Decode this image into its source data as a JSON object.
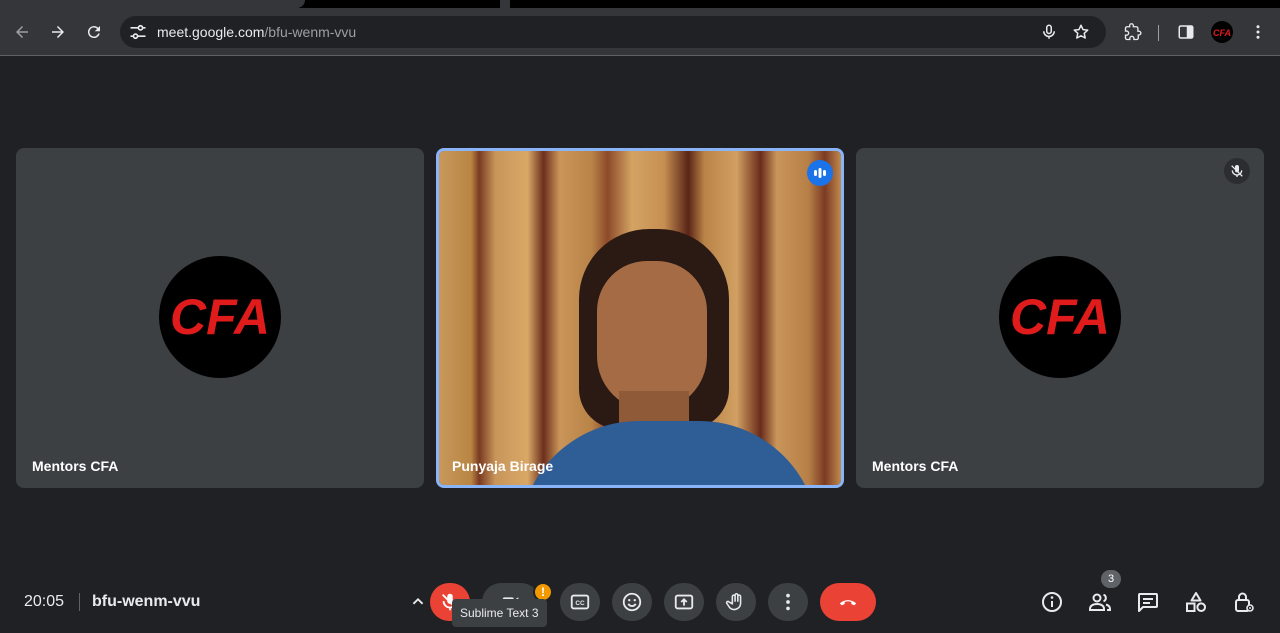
{
  "browser": {
    "url_host": "meet.google.com",
    "url_path": "/bfu-wenm-vvu",
    "profile_text": "CFA"
  },
  "tiles": [
    {
      "name": "Mentors CFA",
      "avatar_text": "CFA",
      "muted": false
    },
    {
      "name": "Punyaja Birage",
      "speaking": true
    },
    {
      "name": "Mentors CFA",
      "avatar_text": "CFA",
      "muted": true
    }
  ],
  "meeting": {
    "time": "20:05",
    "code": "bfu-wenm-vvu"
  },
  "controls": {
    "warning_badge": "!",
    "tooltip": "Sublime Text 3",
    "people_count": "3"
  },
  "colors": {
    "accent": "#8ab4f8",
    "danger": "#ea4335",
    "logo_red": "#e01b1b",
    "speaking_blue": "#1a73e8"
  },
  "icons": [
    "back-icon",
    "forward-icon",
    "reload-icon",
    "tune-icon",
    "mic-icon",
    "star-icon",
    "extensions-icon",
    "side-panel-icon",
    "menu-icon",
    "mic-off-icon",
    "camera-off-icon",
    "captions-icon",
    "emoji-icon",
    "present-icon",
    "raise-hand-icon",
    "more-icon",
    "end-call-icon",
    "info-icon",
    "people-icon",
    "chat-icon",
    "activities-icon",
    "host-controls-icon"
  ]
}
